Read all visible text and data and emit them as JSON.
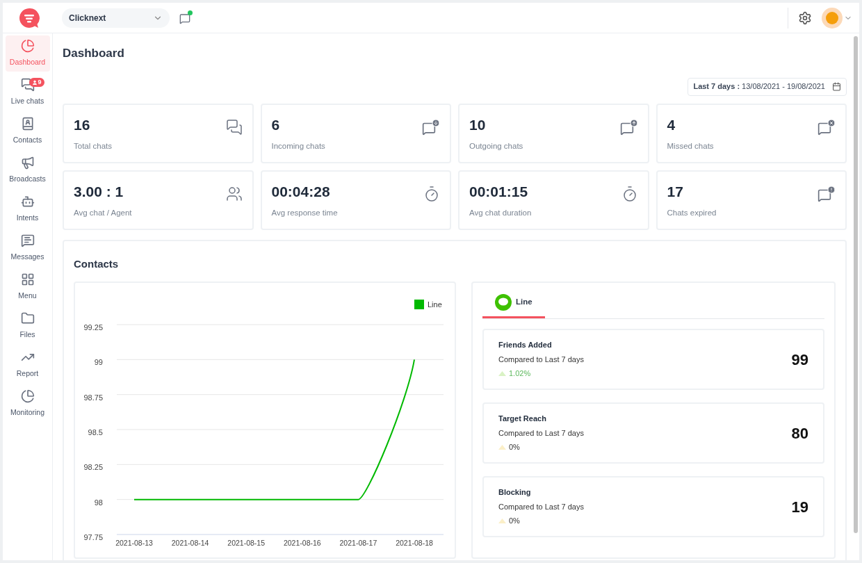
{
  "workspace": {
    "value": "Clicknext"
  },
  "sidebar": {
    "items": [
      {
        "label": "Dashboard",
        "selected": true
      },
      {
        "label": "Live chats",
        "selected": false,
        "badge": "9"
      },
      {
        "label": "Contacts",
        "selected": false
      },
      {
        "label": "Broadcasts",
        "selected": false
      },
      {
        "label": "Intents",
        "selected": false
      },
      {
        "label": "Messages",
        "selected": false
      },
      {
        "label": "Menu",
        "selected": false
      },
      {
        "label": "Files",
        "selected": false
      },
      {
        "label": "Report",
        "selected": false
      },
      {
        "label": "Monitoring",
        "selected": false
      }
    ]
  },
  "page_title": "Dashboard",
  "date_range": "**Last 7 days :** 13/08/2021 - 19/08/2021",
  "stats": [
    {
      "value": "16",
      "label": "Total chats"
    },
    {
      "value": "6",
      "label": "Incoming chats"
    },
    {
      "value": "10",
      "label": "Outgoing chats"
    },
    {
      "value": "4",
      "label": "Missed chats"
    },
    {
      "value": "3.00 : 1",
      "label": "Avg chat / Agent"
    },
    {
      "value": "00:04:28",
      "label": "Avg response time"
    },
    {
      "value": "00:01:15",
      "label": "Avg chat duration"
    },
    {
      "value": "17",
      "label": "Chats expired"
    }
  ],
  "contacts": {
    "title": "Contacts",
    "chart_data": {
      "type": "line",
      "grid": true,
      "x": [
        "2021-08-13",
        "2021-08-14",
        "2021-08-15",
        "2021-08-16",
        "2021-08-17",
        "2021-08-18"
      ],
      "series": [
        {
          "name": "Line",
          "color": "#00b900",
          "values": [
            98,
            98,
            98,
            98,
            98,
            99
          ]
        }
      ],
      "ylim": [
        97.75,
        99.25
      ],
      "yticks": [
        97.75,
        98,
        98.25,
        98.5,
        98.75,
        99,
        99.25
      ]
    },
    "tabs": [
      {
        "label": "Line",
        "selected": true
      }
    ],
    "metrics": [
      {
        "title": "Friends Added",
        "subtitle": "Compared to Last 7 days",
        "change": "1.02%",
        "kind": "increase",
        "value": "99"
      },
      {
        "title": "Target Reach",
        "subtitle": "Compared to Last 7 days",
        "change": "0%",
        "kind": "neutral",
        "value": "80"
      },
      {
        "title": "Blocking",
        "subtitle": "Compared to Last 7 days",
        "change": "0%",
        "kind": "neutral",
        "value": "19"
      }
    ]
  }
}
